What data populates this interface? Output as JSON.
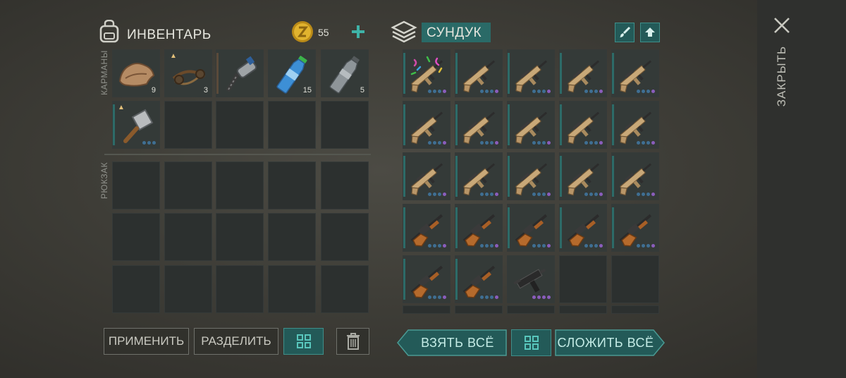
{
  "inventory": {
    "title": "ИНВЕНТАРЬ",
    "currency": "55",
    "pockets_label": "КАРМАНЫ",
    "backpack_label": "РЮКЗАК",
    "pocket_items": [
      {
        "name": "hide-item",
        "qty": "9"
      },
      {
        "name": "bola-item",
        "qty": "3"
      },
      {
        "name": "drill-item",
        "qty": ""
      },
      {
        "name": "water-bottle-item",
        "qty": "15"
      },
      {
        "name": "empty-bottle-item",
        "qty": "5"
      },
      {
        "name": "cleaver-item",
        "qty": ""
      }
    ]
  },
  "chest": {
    "title": "СУНДУК",
    "items": [
      "festive-assault-rifle",
      "assault-rifle",
      "assault-rifle",
      "assault-rifle",
      "assault-rifle",
      "assault-rifle",
      "assault-rifle",
      "assault-rifle",
      "assault-rifle",
      "assault-rifle",
      "assault-rifle",
      "assault-rifle",
      "assault-rifle",
      "assault-rifle",
      "assault-rifle",
      "sks-rifle",
      "sks-rifle",
      "sks-rifle",
      "sks-rifle",
      "sks-rifle",
      "sks-rifle",
      "sks-rifle",
      "uzi-smg"
    ]
  },
  "buttons": {
    "apply": "ПРИМЕНИТЬ",
    "split": "РАЗДЕЛИТЬ",
    "take_all": "ВЗЯТЬ ВСЁ",
    "put_all": "СЛОЖИТЬ ВСЁ",
    "close": "ЗАКРЫТЬ"
  },
  "icons": {
    "backpack": "backpack-icon",
    "coin": "coin-icon",
    "chest": "chest-icon",
    "brush": "brush-icon",
    "upload": "upload-arrow-icon",
    "sort": "sort-grid-icon",
    "trash": "trash-icon",
    "close": "close-icon"
  },
  "colors": {
    "accent_teal": "#2a6a67",
    "rarity_blue": "#3f6f93",
    "rarity_purple": "#8a5dbc",
    "coin_gold": "#e1b32e"
  }
}
